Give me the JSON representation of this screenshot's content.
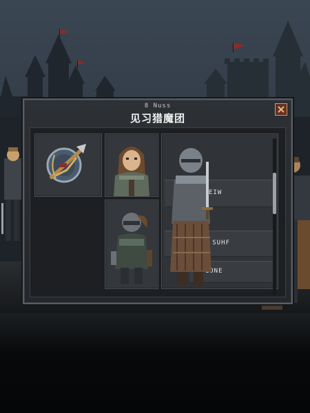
{
  "dialog": {
    "subtitle": "8 Nuss",
    "title": "见习猎魔团"
  },
  "roster": {
    "rows": [
      {
        "text": "EIW"
      },
      {
        "text": "MJ SUHF"
      },
      {
        "text": ": 1ONE"
      }
    ]
  },
  "colors": {
    "panel": "#2d3035",
    "slot": "#34373b",
    "close": "#5b2a22",
    "accent_gold": "#c9a65a"
  },
  "icons": {
    "item": "crossbow-shield-icon",
    "close": "close-icon"
  }
}
